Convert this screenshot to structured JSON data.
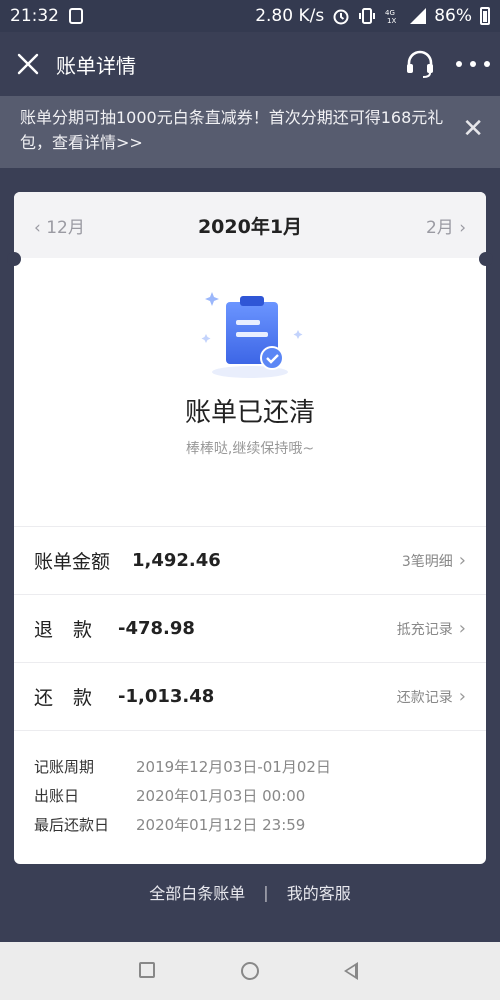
{
  "status_bar": {
    "time": "21:32",
    "speed": "2.80 K/s",
    "battery": "86%"
  },
  "header": {
    "title": "账单详情"
  },
  "banner": {
    "text": "账单分期可抽1000元白条直减券！首次分期还可得168元礼包，查看详情>>"
  },
  "month_nav": {
    "prev": "12月",
    "current": "2020年1月",
    "next": "2月"
  },
  "status": {
    "title": "账单已还清",
    "subtitle": "棒棒哒,继续保持哦~"
  },
  "rows": [
    {
      "label": "账单金额",
      "amount": "1,492.46",
      "link": "3笔明细"
    },
    {
      "label": "退款",
      "amount": "-478.98",
      "link": "抵充记录"
    },
    {
      "label": "还款",
      "amount": "-1,013.48",
      "link": "还款记录"
    }
  ],
  "details": [
    {
      "label": "记账周期",
      "value": "2019年12月03日-01月02日"
    },
    {
      "label": "出账日",
      "value": "2020年01月03日 00:00"
    },
    {
      "label": "最后还款日",
      "value": "2020年01月12日 23:59"
    }
  ],
  "footer": {
    "all_bills": "全部白条账单",
    "separator": "|",
    "service": "我的客服"
  },
  "colors": {
    "background": "#3a3f55",
    "accent": "#4a7cf0"
  },
  "icons": [
    "close-icon",
    "headset-icon",
    "more-icon",
    "clipboard-check-icon",
    "chevron-right-icon"
  ]
}
